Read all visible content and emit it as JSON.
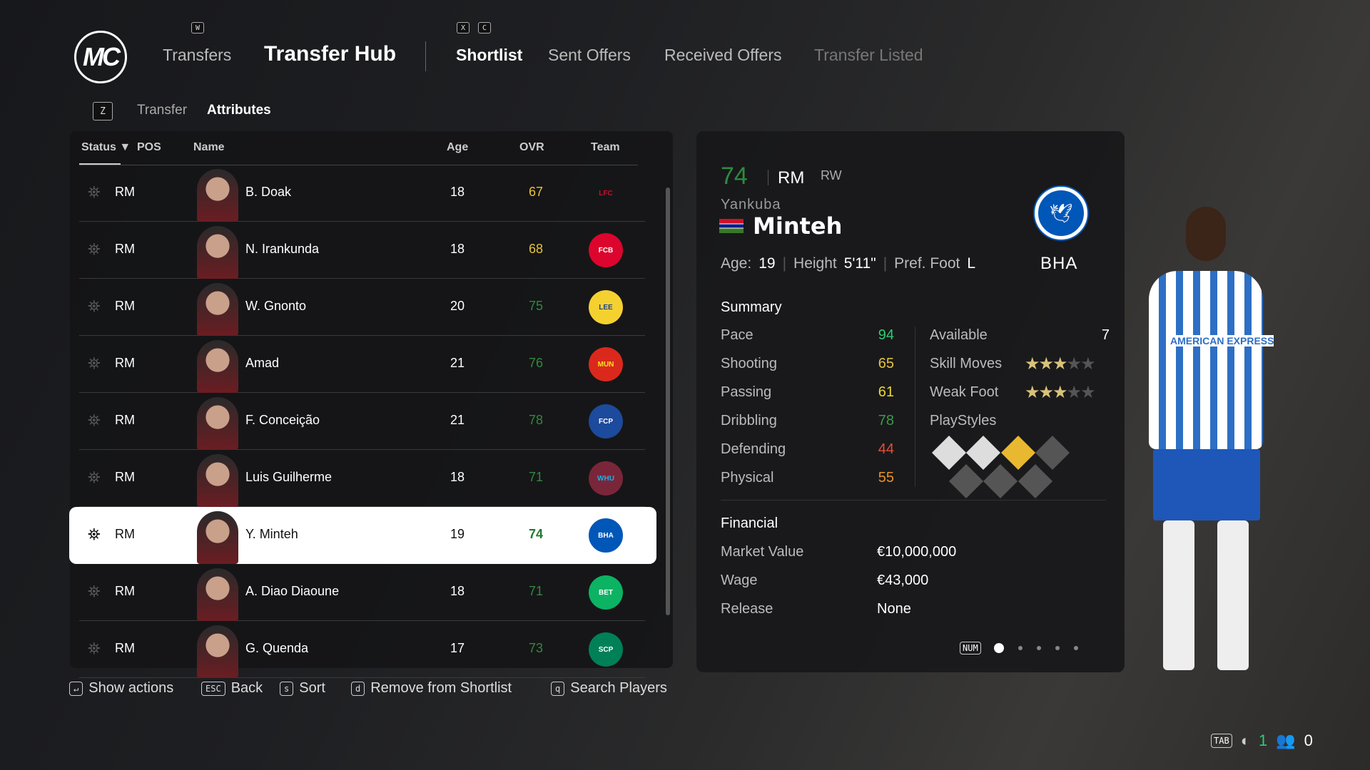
{
  "header": {
    "logo": "MC",
    "tabs_left": [
      {
        "label": "Transfers",
        "key": "W"
      },
      {
        "label": "Transfer Hub"
      }
    ],
    "tabs": [
      {
        "label": "Shortlist",
        "key": "X"
      },
      {
        "label": "Sent Offers",
        "key": "C"
      },
      {
        "label": "Received Offers"
      },
      {
        "label": "Transfer Listed"
      }
    ],
    "subtabs": {
      "key": "Z",
      "items": [
        "Transfer",
        "Attributes"
      ]
    }
  },
  "table": {
    "columns": [
      "Status",
      "POS",
      "Name",
      "Age",
      "OVR",
      "Team"
    ],
    "rows": [
      {
        "pos": "RM",
        "name": "B. Doak",
        "age": "18",
        "ovr": "67",
        "ovr_color": "#e8c23a",
        "team": "LFC",
        "crest": "#c8102e",
        "crest_bg": "transparent"
      },
      {
        "pos": "RM",
        "name": "N. Irankunda",
        "age": "18",
        "ovr": "68",
        "ovr_color": "#e8c23a",
        "team": "FCB",
        "crest": "#fff",
        "crest_bg": "#dc052d"
      },
      {
        "pos": "RM",
        "name": "W. Gnonto",
        "age": "20",
        "ovr": "75",
        "ovr_color": "#2f8a3e",
        "team": "LEE",
        "crest": "#1d428a",
        "crest_bg": "#f5d130"
      },
      {
        "pos": "RM",
        "name": "Amad",
        "age": "21",
        "ovr": "76",
        "ovr_color": "#2f8a3e",
        "team": "MUN",
        "crest": "#fbe122",
        "crest_bg": "#da291c"
      },
      {
        "pos": "RM",
        "name": "F. Conceição",
        "age": "21",
        "ovr": "78",
        "ovr_color": "#2f8a3e",
        "team": "FCP",
        "crest": "#fff",
        "crest_bg": "#1c4a9c"
      },
      {
        "pos": "RM",
        "name": "Luis Guilherme",
        "age": "18",
        "ovr": "71",
        "ovr_color": "#2f8a3e",
        "team": "WHU",
        "crest": "#1bb1e7",
        "crest_bg": "#7a263a"
      },
      {
        "pos": "RM",
        "name": "Y. Minteh",
        "age": "19",
        "ovr": "74",
        "ovr_color": "#1f7a30",
        "team": "BHA",
        "crest": "#fff",
        "crest_bg": "#0057b8",
        "selected": true
      },
      {
        "pos": "RM",
        "name": "A. Diao Diaoune",
        "age": "18",
        "ovr": "71",
        "ovr_color": "#2f8a3e",
        "team": "BET",
        "crest": "#fff",
        "crest_bg": "#0bb363"
      },
      {
        "pos": "RM",
        "name": "G. Quenda",
        "age": "17",
        "ovr": "73",
        "ovr_color": "#2f8a3e",
        "team": "SCP",
        "crest": "#fff",
        "crest_bg": "#008057"
      }
    ]
  },
  "player": {
    "ovr": "74",
    "pos": "RM",
    "alt_pos": "RW",
    "first_name": "Yankuba",
    "last_name": "Minteh",
    "age_label": "Age:",
    "age": "19",
    "height_label": "Height",
    "height": "5'11\"",
    "foot_label": "Pref. Foot",
    "foot": "L",
    "club": "BHA",
    "summary_title": "Summary",
    "stats": [
      {
        "label": "Pace",
        "value": "94",
        "color": "#2ecc71"
      },
      {
        "label": "Shooting",
        "value": "65",
        "color": "#e8c23a"
      },
      {
        "label": "Passing",
        "value": "61",
        "color": "#e8d83a"
      },
      {
        "label": "Dribbling",
        "value": "78",
        "color": "#3a9a4a"
      },
      {
        "label": "Defending",
        "value": "44",
        "color": "#e74c3c"
      },
      {
        "label": "Physical",
        "value": "55",
        "color": "#e8902a"
      }
    ],
    "available_label": "Available",
    "available": "7",
    "skill_label": "Skill Moves",
    "skill_stars": 3,
    "weak_label": "Weak Foot",
    "weak_stars": 3,
    "playstyles_label": "PlayStyles",
    "financial_title": "Financial",
    "financial": [
      {
        "label": "Market Value",
        "value": "€10,000,000"
      },
      {
        "label": "Wage",
        "value": "€43,000"
      },
      {
        "label": "Release",
        "value": "None"
      }
    ],
    "pager": {
      "key": "NUM",
      "pages": 5,
      "current": 1
    }
  },
  "hints": [
    {
      "key": "↵",
      "label": "Show actions"
    },
    {
      "key": "ESC",
      "label": "Back"
    },
    {
      "key": "s",
      "label": "Sort"
    },
    {
      "key": "d",
      "label": "Remove from Shortlist"
    },
    {
      "key": "q",
      "label": "Search Players"
    }
  ],
  "status_bar": {
    "key": "TAB",
    "count1": "1",
    "count2": "0"
  }
}
